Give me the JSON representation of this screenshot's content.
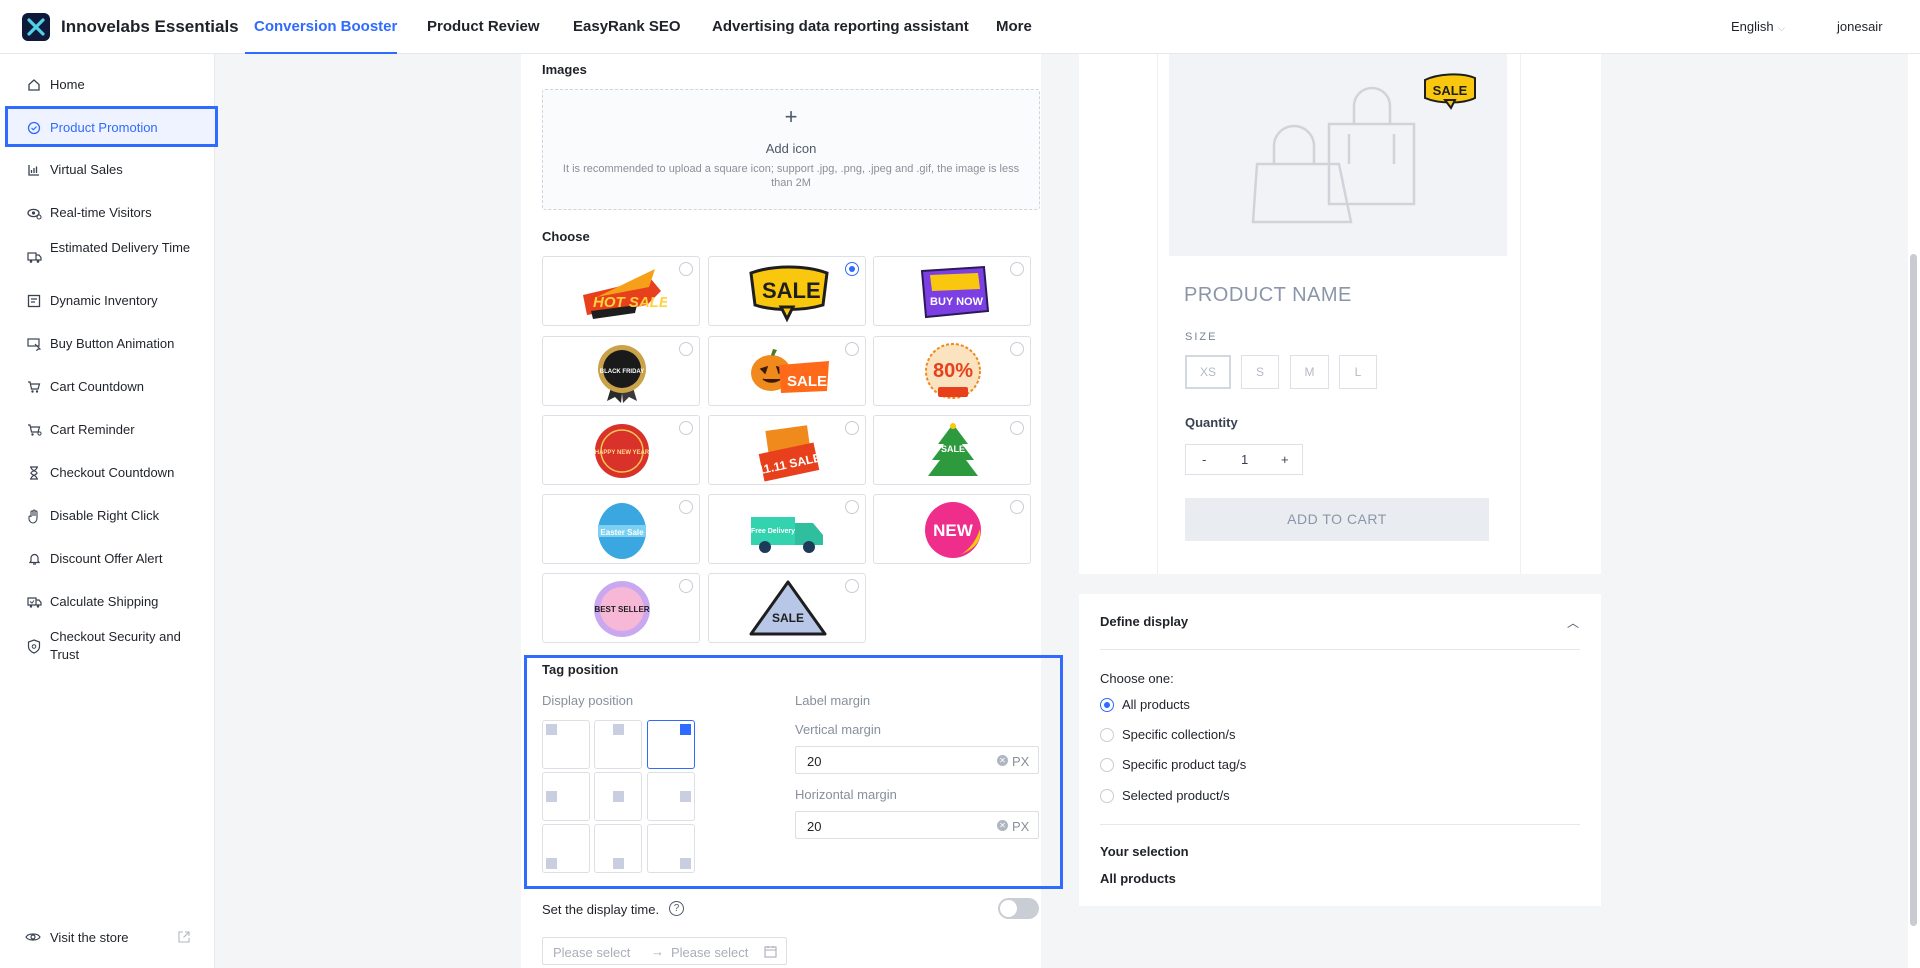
{
  "app": {
    "brand": "Innovelabs Essentials",
    "language": "English",
    "user": "jonesair"
  },
  "nav": {
    "tabs": [
      {
        "label": "Conversion Booster",
        "active": true
      },
      {
        "label": "Product Review"
      },
      {
        "label": "EasyRank SEO"
      },
      {
        "label": "Advertising data reporting assistant"
      },
      {
        "label": "More"
      }
    ]
  },
  "sidebar": {
    "items": [
      {
        "label": "Home",
        "icon": "home-icon"
      },
      {
        "label": "Product Promotion",
        "icon": "badge-icon",
        "active": true
      },
      {
        "label": "Virtual Sales",
        "icon": "chart-icon"
      },
      {
        "label": "Real-time Visitors",
        "icon": "visitors-icon"
      },
      {
        "label": "Estimated Delivery Time",
        "icon": "truck-icon"
      },
      {
        "label": "Dynamic Inventory",
        "icon": "inventory-icon"
      },
      {
        "label": "Buy Button Animation",
        "icon": "cursor-icon"
      },
      {
        "label": "Cart Countdown",
        "icon": "cart-icon"
      },
      {
        "label": "Cart Reminder",
        "icon": "cart-reminder-icon"
      },
      {
        "label": "Checkout Countdown",
        "icon": "hourglass-icon"
      },
      {
        "label": "Disable Right Click",
        "icon": "hand-icon"
      },
      {
        "label": "Discount Offer Alert",
        "icon": "bell-icon"
      },
      {
        "label": "Calculate Shipping",
        "icon": "shipping-icon"
      },
      {
        "label": "Checkout Security and Trust",
        "icon": "shield-icon"
      }
    ],
    "visit_store": "Visit the store"
  },
  "editor": {
    "images_title": "Images",
    "upload": {
      "plus": "+",
      "title": "Add icon",
      "hint": "It is recommended to upload a square icon; support .jpg, .png, .jpeg and .gif, the image is less than 2M"
    },
    "choose_title": "Choose",
    "tags": [
      {
        "name": "hot-sale",
        "text": "HOT SALE",
        "selected": false
      },
      {
        "name": "sale",
        "text": "SALE",
        "selected": true
      },
      {
        "name": "buy-now",
        "text": "BUY NOW",
        "selected": false
      },
      {
        "name": "black-friday",
        "text": "BLACK FRIDAY",
        "selected": false
      },
      {
        "name": "halloween-sale",
        "text": "SALE",
        "selected": false
      },
      {
        "name": "80-off-sale",
        "text": "80%",
        "selected": false
      },
      {
        "name": "happy-new-year",
        "text": "HAPPY NEW YEAR",
        "selected": false
      },
      {
        "name": "11-11-sale",
        "text": "11.11 SALE",
        "selected": false
      },
      {
        "name": "christmas-sale",
        "text": "SALE",
        "selected": false
      },
      {
        "name": "easter-sale",
        "text": "Easter Sale",
        "selected": false
      },
      {
        "name": "free-delivery",
        "text": "Free Delivery",
        "selected": false
      },
      {
        "name": "new",
        "text": "NEW",
        "selected": false
      },
      {
        "name": "best-seller",
        "text": "BEST SELLER",
        "selected": false
      },
      {
        "name": "special-discount",
        "text": "SALE",
        "selected": false
      }
    ],
    "tag_position_title": "Tag position",
    "display_position_label": "Display position",
    "label_margin_label": "Label margin",
    "selected_position": "top-right",
    "vertical_margin": {
      "label": "Vertical margin",
      "value": "20",
      "unit": "PX"
    },
    "horizontal_margin": {
      "label": "Horizontal margin",
      "value": "20",
      "unit": "PX"
    },
    "display_time_label": "Set the display time.",
    "display_time_enabled": false,
    "date_start_placeholder": "Please select",
    "date_end_placeholder": "Please select"
  },
  "preview": {
    "badge_text": "SALE",
    "product_name": "PRODUCT NAME",
    "size_label": "SIZE",
    "sizes": [
      "XS",
      "S",
      "M",
      "L"
    ],
    "quantity_label": "Quantity",
    "qty_minus": "-",
    "qty_value": "1",
    "qty_plus": "+",
    "add_to_cart": "ADD TO CART"
  },
  "define_display": {
    "title": "Define display",
    "choose_one": "Choose one:",
    "options": [
      {
        "label": "All products",
        "selected": true
      },
      {
        "label": "Specific collection/s",
        "selected": false
      },
      {
        "label": "Specific product tag/s",
        "selected": false
      },
      {
        "label": "Selected product/s",
        "selected": false
      }
    ],
    "your_selection_label": "Your selection",
    "your_selection_value": "All products"
  },
  "colors": {
    "accent": "#2f6bff",
    "sale_yellow": "#f9c80e"
  }
}
